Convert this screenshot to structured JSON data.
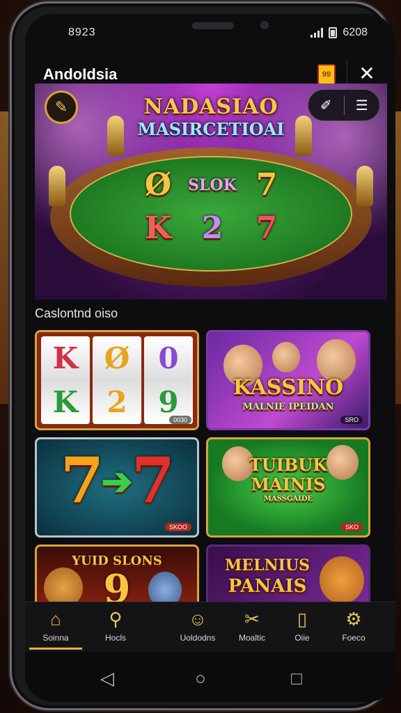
{
  "status": {
    "time": "8923",
    "right_text": "6208"
  },
  "appbar": {
    "title": "AndoIdsia",
    "badge": "99",
    "close": "✕"
  },
  "hero": {
    "title_line1": "NADASIAO",
    "title_line2": "MASIRCETIOAI",
    "edit_icon": "✎",
    "tool_brush": "✐",
    "tool_menu": "☰",
    "symbols": [
      "Ø",
      "SLOK",
      "7",
      "K",
      "2",
      "7"
    ]
  },
  "section": {
    "title": "Caslontnd oiso"
  },
  "tiles": [
    {
      "name": "reels",
      "reels": [
        [
          "K",
          "K"
        ],
        [
          "Ø",
          "2"
        ],
        [
          "0",
          "9"
        ]
      ],
      "tag": "0030"
    },
    {
      "name": "kasino",
      "line1": "KASSINO",
      "line2": "MALNIE IPEIDAN",
      "tag": "SRO"
    },
    {
      "name": "sevens",
      "left": "7",
      "right": "7",
      "arrow": "➔",
      "tag": "SKOO"
    },
    {
      "name": "tuibuk",
      "line1": "TUIBUK",
      "line2": "MAINIS",
      "line3": "MASSGAIDE",
      "tag": "SKO"
    },
    {
      "name": "yuid",
      "line1": "YUID SLONS",
      "big": "9"
    },
    {
      "name": "melnius",
      "line1": "MELNIUS",
      "line2": "PANAIS"
    }
  ],
  "nav": [
    {
      "label": "Soinna",
      "icon": "⌂"
    },
    {
      "label": "Hocls",
      "icon": "⚲"
    },
    {
      "label": "Uoldodns",
      "icon": "☺"
    },
    {
      "label": "Moaltic",
      "icon": "✂"
    },
    {
      "label": "Oiie",
      "icon": "▯"
    },
    {
      "label": "Foeco",
      "icon": "⚙"
    }
  ],
  "sysnav": {
    "back": "◁",
    "home": "○",
    "recent": "□"
  },
  "colors": {
    "accent": "#e8b23a",
    "felt": "#1f7a22",
    "hero_bg": "#6b1f8a"
  }
}
